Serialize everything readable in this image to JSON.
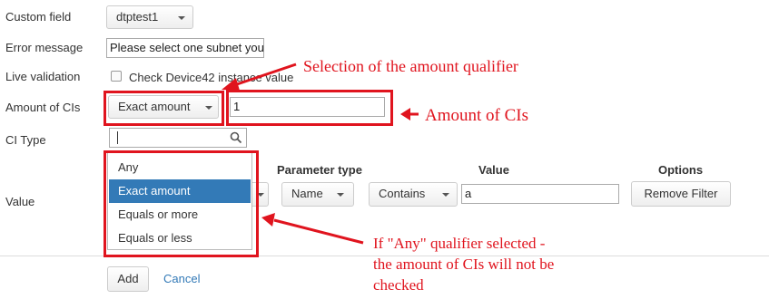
{
  "form": {
    "custom_field_label": "Custom field",
    "custom_field_value": "dtptest1",
    "error_message_label": "Error message",
    "error_message_value": "Please select one subnet you",
    "live_validation_label": "Live validation",
    "live_validation_checkbox_label": "Check Device42 instance value",
    "amount_label": "Amount of CIs",
    "amount_qualifier_value": "Exact amount",
    "amount_value": "1",
    "ci_type_label": "CI Type",
    "value_label": "Value"
  },
  "filter_table": {
    "headers": {
      "parameter_type": "Parameter type",
      "value": "Value",
      "options": "Options"
    },
    "row": {
      "parameter_type": "Name",
      "operator": "Contains",
      "value": "a",
      "remove_label": "Remove Filter"
    }
  },
  "dropdown": {
    "options": [
      "Any",
      "Exact amount",
      "Equals or more",
      "Equals or less"
    ],
    "selected": "Exact amount"
  },
  "footer": {
    "add_label": "Add",
    "cancel_label": "Cancel"
  },
  "annotations": {
    "qualifier": "Selection of the amount qualifier",
    "amount": "Amount of CIs",
    "any_line1": "If \"Any\" qualifier selected -",
    "any_line2": "the amount of CIs will not be",
    "any_line3": "checked"
  },
  "colors": {
    "annotation_red": "#e0141e",
    "selected_blue": "#337ab7",
    "link_blue": "#337ab7"
  }
}
